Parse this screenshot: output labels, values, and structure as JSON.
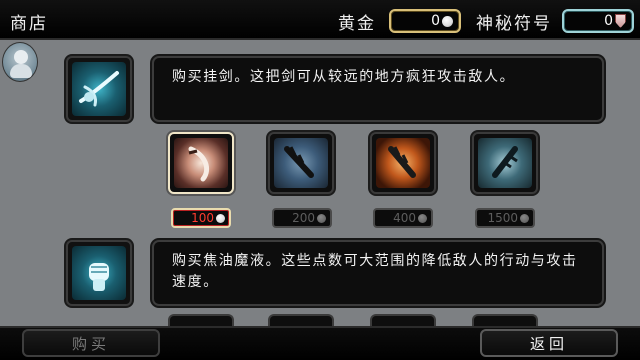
{
  "header": {
    "title": "商店",
    "gold_label": "黄金",
    "gold_value": "0",
    "mystic_label": "神秘符号",
    "mystic_value": "0"
  },
  "rows": [
    {
      "icon": "hook-sword-icon",
      "description": "购买挂剑。这把剑可从较远的地方疯狂攻击敌人。",
      "items": [
        {
          "icon": "curved-blade-icon",
          "price": "100",
          "affordable_style": true
        },
        {
          "icon": "serrated-spear-icon",
          "price": "200"
        },
        {
          "icon": "flaming-spear-icon",
          "price": "400"
        },
        {
          "icon": "frost-spear-icon",
          "price": "1500"
        }
      ]
    },
    {
      "icon": "fist-icon",
      "description": "购买焦油魔液。这些点数可大范围的降低敌人的行动与攻击速度。"
    }
  ],
  "footer": {
    "buy_label": "购买",
    "back_label": "返回"
  },
  "colors": {
    "background": "#7d8083",
    "gold_border": "#d9c07a",
    "mystic_border": "#9fd3d8",
    "price_active": "#ff3b2f"
  }
}
